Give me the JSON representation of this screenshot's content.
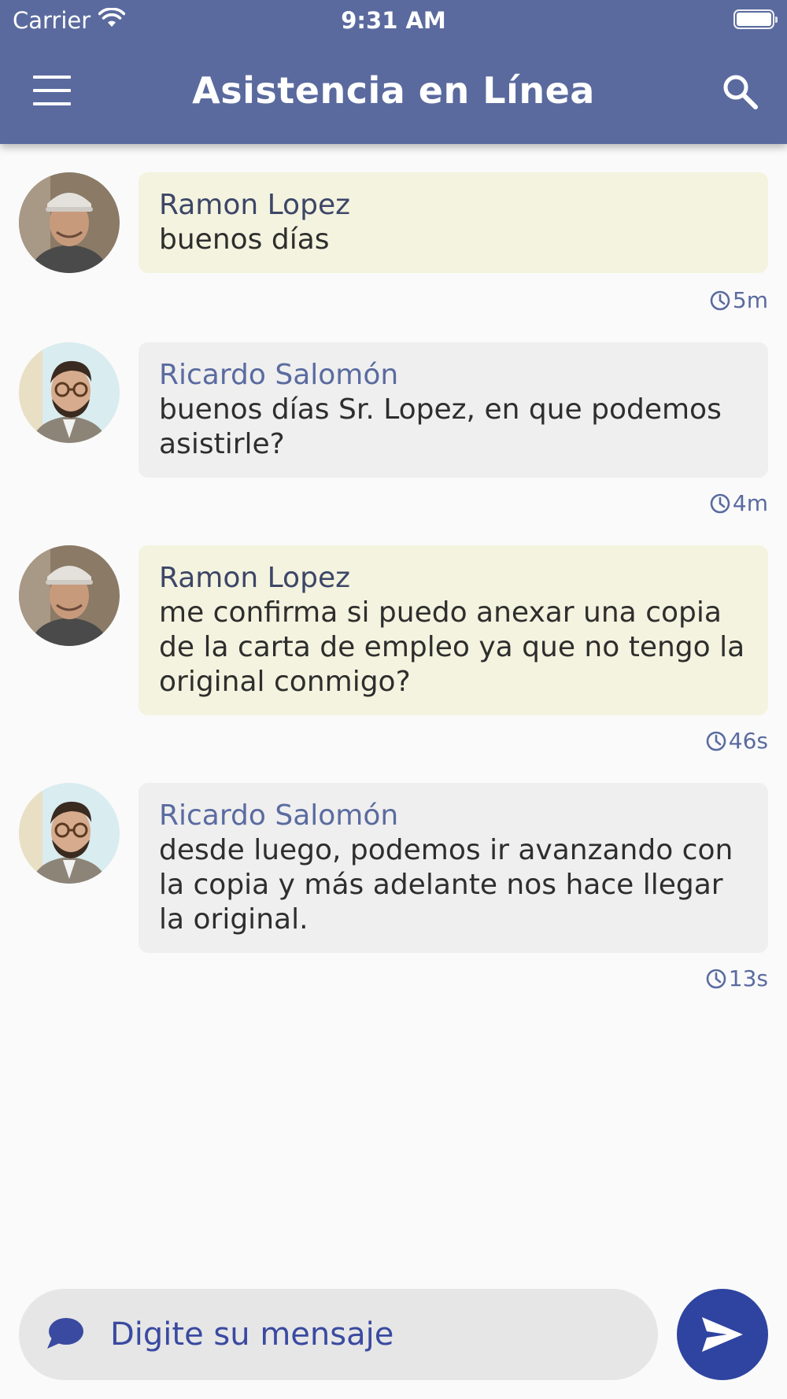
{
  "status_bar": {
    "carrier": "Carrier",
    "time": "9:31 AM",
    "icons": [
      "wifi-icon",
      "battery-icon"
    ]
  },
  "header": {
    "title": "Asistencia en Línea",
    "menu_icon": "hamburger-menu-icon",
    "search_icon": "search-icon",
    "background_color": "#5a6a9e"
  },
  "messages": [
    {
      "sender": "Ramon Lopez",
      "role": "client",
      "text": "buenos días",
      "time": "5m"
    },
    {
      "sender": "Ricardo Salomón",
      "role": "agent",
      "text": "buenos días Sr. Lopez, en que podemos asistirle?",
      "time": "4m"
    },
    {
      "sender": "Ramon Lopez",
      "role": "client",
      "text": "me confirma si puedo anexar una copia de la carta de empleo ya que no tengo la original conmigo?",
      "time": "46s"
    },
    {
      "sender": "Ricardo Salomón",
      "role": "agent",
      "text": "desde luego, podemos ir avanzando con la copia y más adelante nos hace llegar la original.",
      "time": "13s"
    }
  ],
  "composer": {
    "placeholder": "Digite su mensaje",
    "value": "",
    "chat_icon": "chat-bubble-icon",
    "send_icon": "send-icon",
    "send_button_color": "#2f44a0"
  },
  "colors": {
    "client_bubble": "#f3f3df",
    "agent_bubble": "#efefef",
    "agent_name": "#5a6ba0",
    "client_name": "#3d4667"
  }
}
